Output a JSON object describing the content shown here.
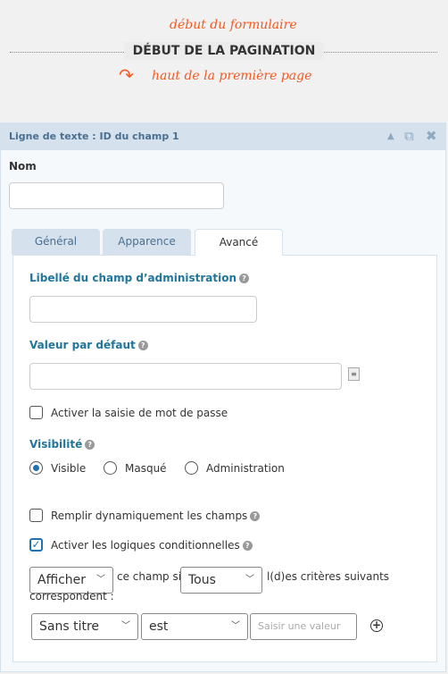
{
  "annotations": {
    "top": "début du formulaire",
    "bottom": "haut de la première page"
  },
  "pagination_title": "DÉBUT DE LA PAGINATION",
  "panel": {
    "title": "Ligne de texte : ID du champ 1",
    "icons": [
      "collapse-up-icon",
      "duplicate-icon",
      "delete-icon"
    ],
    "name_label": "Nom",
    "name_value": "",
    "tabs": [
      {
        "label": "Général",
        "active": false
      },
      {
        "label": "Apparence",
        "active": false
      },
      {
        "label": "Avancé",
        "active": true
      }
    ],
    "admin_label": {
      "label": "Libellé du champ d’administration",
      "value": ""
    },
    "default_value": {
      "label": "Valeur par défaut",
      "value": ""
    },
    "password_checkbox": {
      "label": "Activer la saisie de mot de passe",
      "checked": false
    },
    "visibility": {
      "label": "Visibilité",
      "options": [
        "Visible",
        "Masqué",
        "Administration"
      ],
      "selected": "Visible"
    },
    "dynamic_checkbox": {
      "label": "Remplir dynamiquement les champs",
      "checked": false
    },
    "conditional_checkbox": {
      "label": "Activer les logiques conditionnelles",
      "checked": true
    },
    "conditional": {
      "action": "Afficher",
      "text1": "ce champ si",
      "match": "Tous",
      "text2": "l(d)es critères suivants",
      "text3": "correspondent :",
      "rule": {
        "field": "Sans titre",
        "operator": "est",
        "value_placeholder": "Saisir une valeur"
      }
    }
  },
  "colors": {
    "accent": "#f15a22",
    "label_blue": "#21759b",
    "header_bg": "#d5e1ec",
    "checkbox_blue": "#2271b1"
  }
}
